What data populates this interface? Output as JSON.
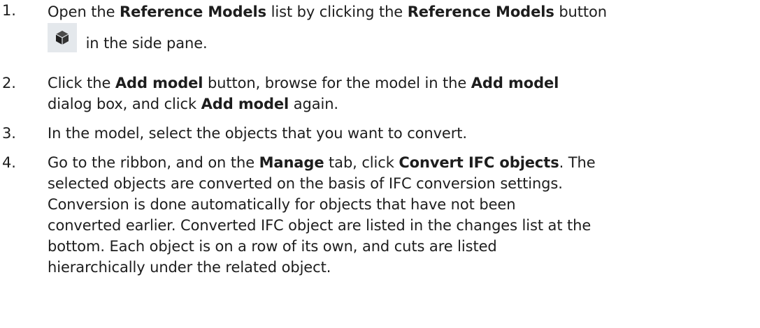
{
  "steps": [
    {
      "num": "1.",
      "parts": {
        "a": "Open the ",
        "b": "Reference Models",
        "c": " list by clicking the ",
        "d": "Reference Models",
        "e": " button",
        "f": " in the side pane."
      },
      "icon": "reference-models-cube-icon"
    },
    {
      "num": "2.",
      "parts": {
        "a": "Click the ",
        "b": "Add model",
        "c": " button, browse for the model in the ",
        "d": "Add model",
        "e": "dialog box, and click ",
        "f": "Add model",
        "g": " again."
      }
    },
    {
      "num": "3.",
      "text": "In the model, select the objects that you want to convert."
    },
    {
      "num": "4.",
      "parts": {
        "a": "Go to the ribbon, and on the ",
        "b": "Manage",
        "c": " tab, click ",
        "d": "Convert IFC objects",
        "e": ". The",
        "l2": "selected objects are converted on the basis of IFC conversion settings.",
        "l3": "Conversion is done automatically for objects that have not been",
        "l4": "converted earlier. Converted IFC object are listed in the changes list at the",
        "l5": "bottom. Each object is on a row of its own, and cuts are listed",
        "l6": "hierarchically under the related object."
      }
    }
  ],
  "colors": {
    "text": "#1d1d1d",
    "icon_bg": "#e4e8ec",
    "icon_fg": "#2b2b2b"
  }
}
